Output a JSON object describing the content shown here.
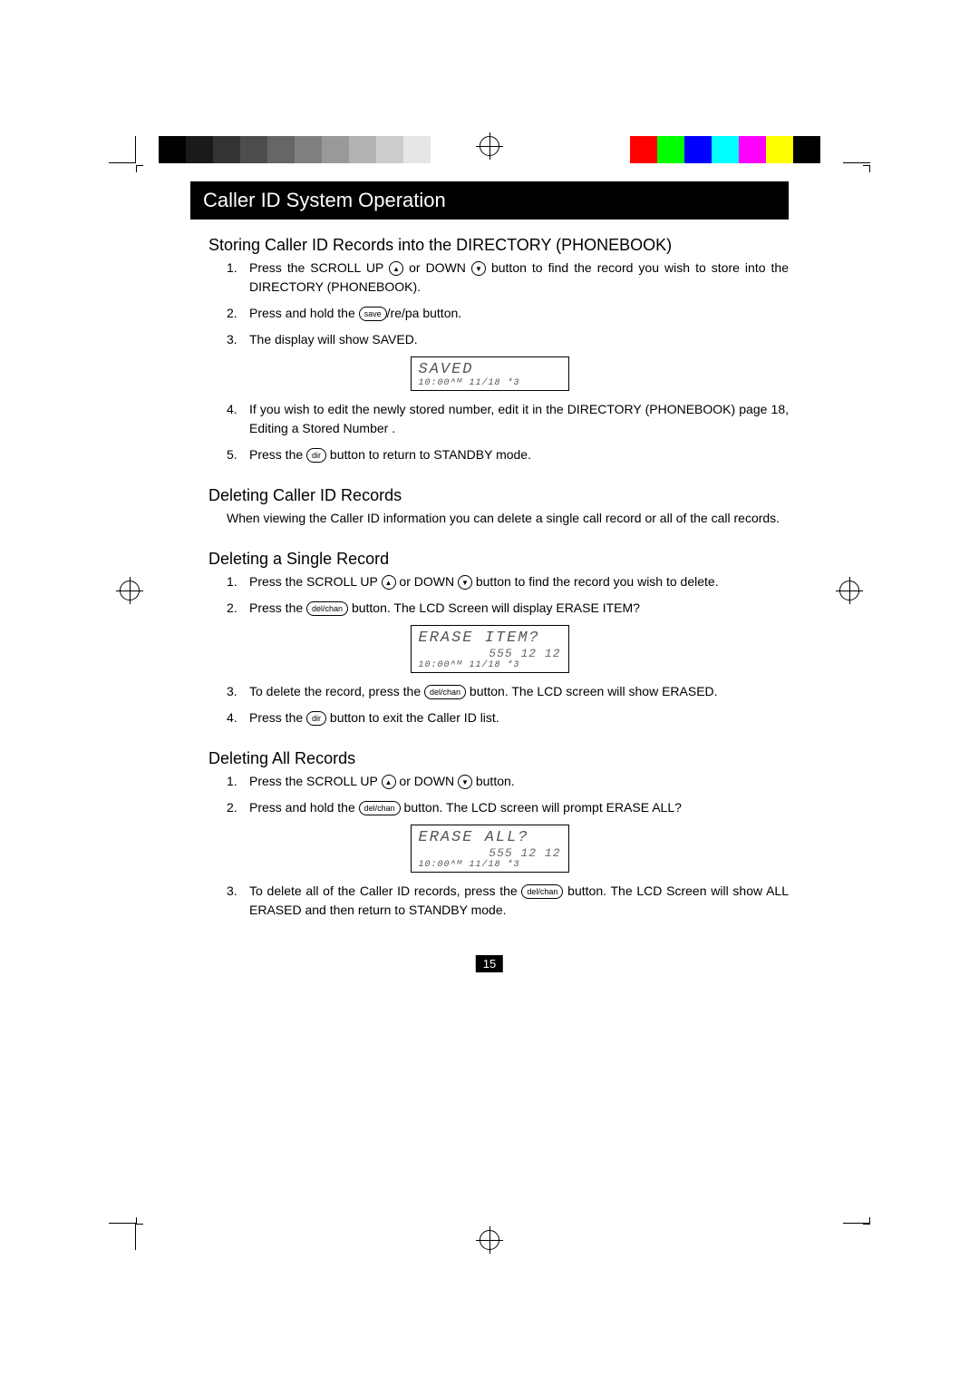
{
  "title": "Caller ID System Operation",
  "pageNumber": "15",
  "sections": {
    "storing": {
      "heading": "Storing Caller ID Records into the DIRECTORY (PHONEBOOK)",
      "items": [
        {
          "num": "1.",
          "pre": "Press the SCROLL UP ",
          "mid": " or DOWN ",
          "post": " button to find the record you wish to store into the DIRECTORY (PHONEBOOK)."
        },
        {
          "num": "2.",
          "pre": "Press and hold the ",
          "btn": "save",
          "post": "/re/pa  button."
        },
        {
          "num": "3.",
          "text": "The display will show  SAVED."
        },
        {
          "num": "4.",
          "text": "If you wish to edit the newly stored number, edit it in the DIRECTORY (PHONEBOOK)  page 18,  Editing a Stored Number ."
        },
        {
          "num": "5.",
          "pre": "Press the ",
          "btn": "dir",
          "post": " button to return to STANDBY mode."
        }
      ],
      "lcd": {
        "line1": "SAVED",
        "line3": "10:00ᴬᴹ 11/18  *3"
      }
    },
    "deleting": {
      "heading": "Deleting Caller ID Records",
      "lead": "When viewing the Caller ID information you can delete a single call record or all of the call records."
    },
    "single": {
      "heading": "Deleting a Single Record",
      "items": [
        {
          "num": "1.",
          "pre": "Press the SCROLL UP ",
          "mid": " or DOWN ",
          "post": " button to find the record you wish to delete."
        },
        {
          "num": "2.",
          "pre": "Press the ",
          "btn": "del/chan",
          "post": " button. The LCD Screen will display  ERASE ITEM?"
        },
        {
          "num": "3.",
          "pre": "To delete the record, press the ",
          "btn": "del/chan",
          "post": " button. The LCD screen will show  ERASED."
        },
        {
          "num": "4.",
          "pre": "Press the ",
          "btn": "dir",
          "post": " button to exit the Caller ID list."
        }
      ],
      "lcd": {
        "line1": "ERASE ITEM?",
        "line2": "555 12 12",
        "line3": "10:00ᴬᴹ 11/18  *3"
      }
    },
    "all": {
      "heading": "Deleting All Records",
      "items": [
        {
          "num": "1.",
          "pre": "Press the SCROLL UP ",
          "mid": " or DOWN ",
          "post": " button."
        },
        {
          "num": "2.",
          "pre": "Press and hold the ",
          "btn": "del/chan",
          "post": " button. The LCD screen will prompt  ERASE ALL?"
        },
        {
          "num": "3.",
          "pre": "To delete all of the Caller ID records, press the ",
          "btn": "del/chan",
          "post": " button. The LCD Screen will show  ALL ERASED  and then return to STANDBY mode."
        }
      ],
      "lcd": {
        "line1": "ERASE ALL?",
        "line2": "555 12 12",
        "line3": "10:00ᴬᴹ 11/18  *3"
      }
    }
  }
}
